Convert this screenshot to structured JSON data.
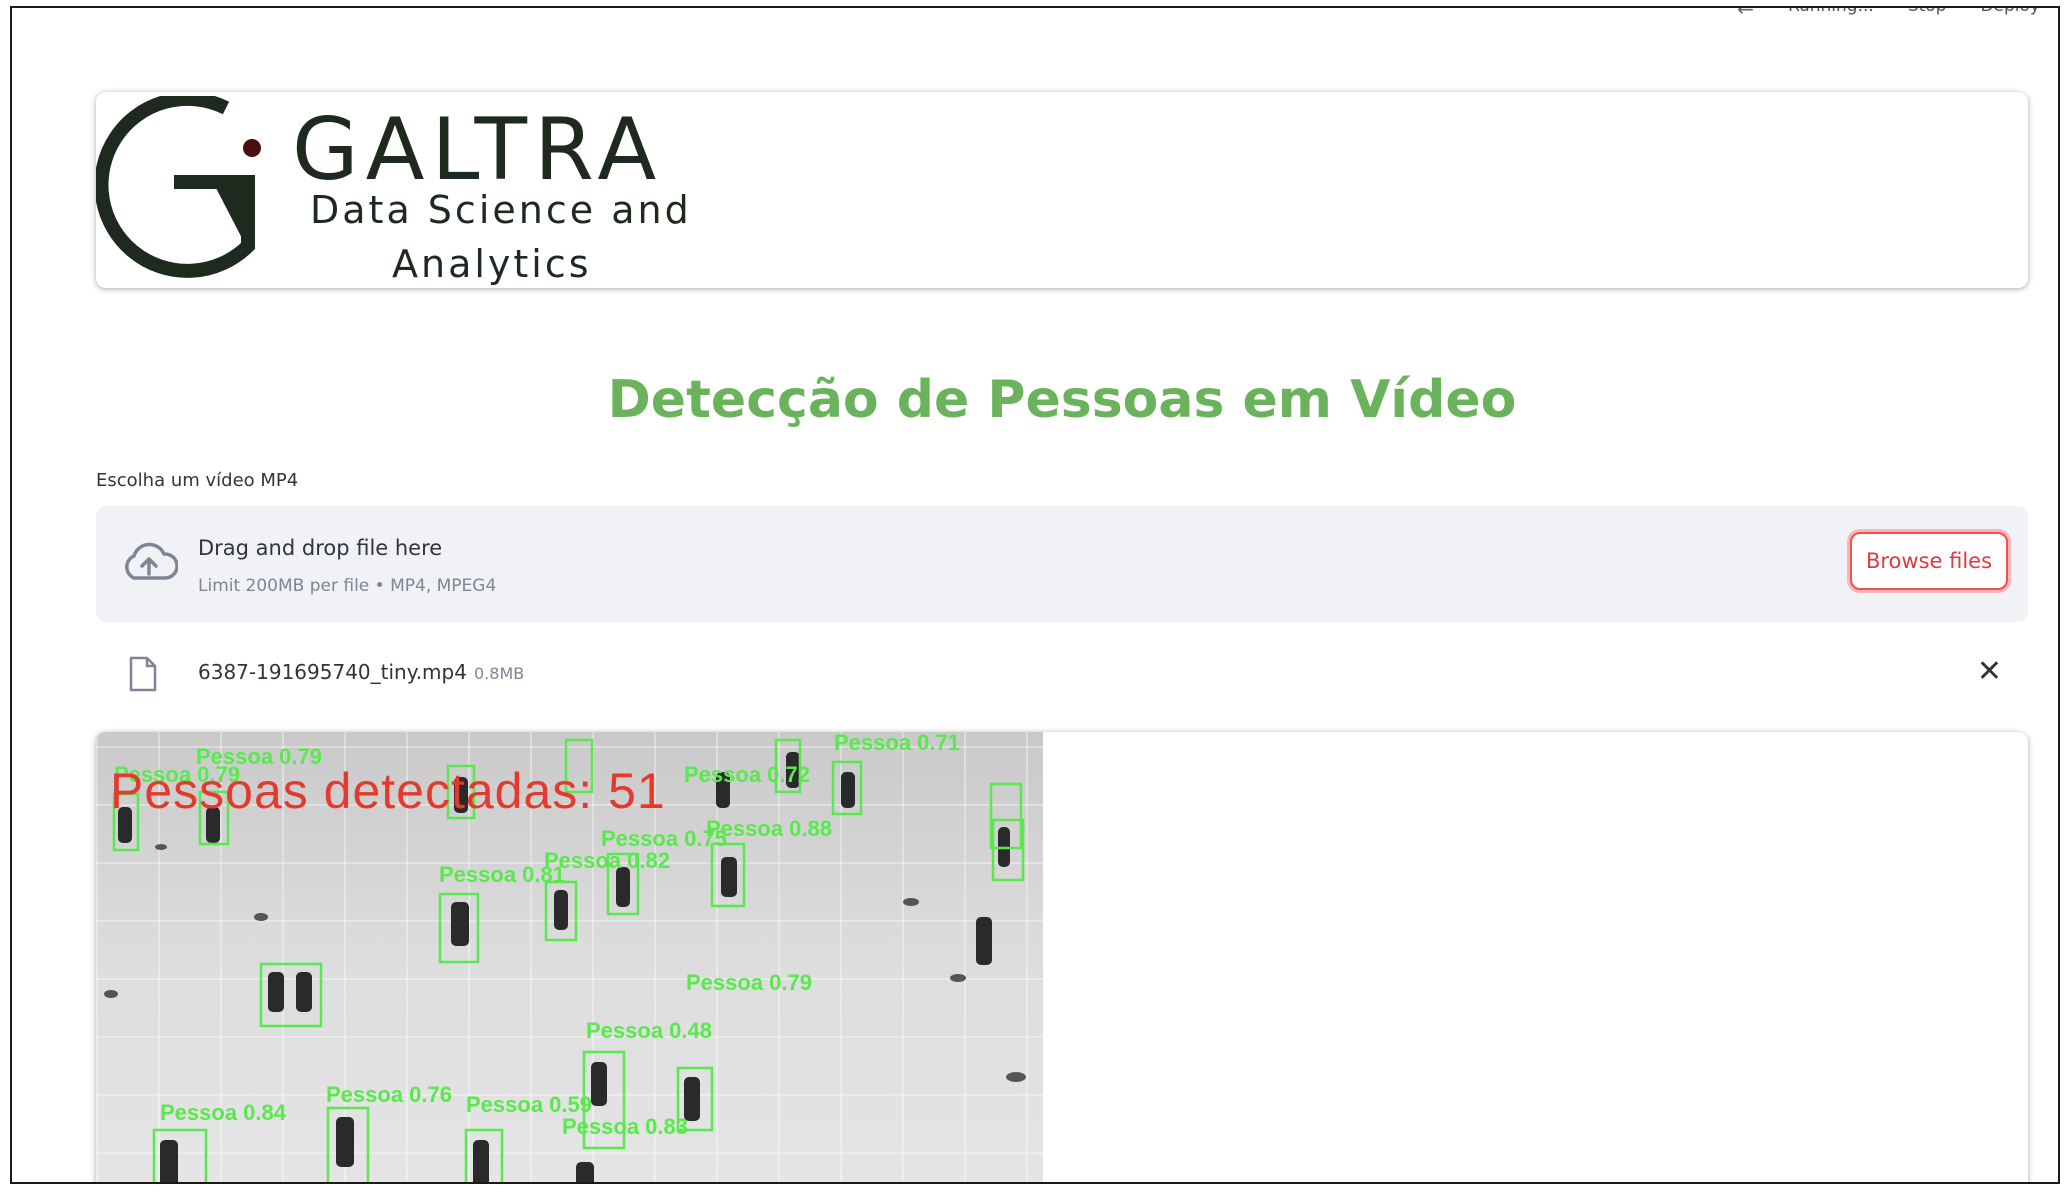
{
  "toolbar": {
    "running_label": "Running...",
    "stop_label": "Stop",
    "deploy_label": "Deploy"
  },
  "logo": {
    "title": "GALTRA",
    "subtitle_line1": "Data Science and",
    "subtitle_line2": "Analytics"
  },
  "page": {
    "title": "Detecção de Pessoas em Vídeo"
  },
  "uploader": {
    "label": "Escolha um vídeo MP4",
    "drop_text": "Drag and drop file here",
    "limit_text": "Limit 200MB per file • MP4, MPEG4",
    "browse_label": "Browse files",
    "icon": "cloud-upload-icon"
  },
  "file": {
    "name": "6387-191695740_tiny.mp4",
    "size": "0.8MB",
    "icon": "file-icon",
    "remove_icon": "close-icon"
  },
  "video": {
    "count_text": "Pessoas detectadas: 51",
    "detections": [
      "Pessoa 0.79",
      "Pessoa 0.79",
      "Pessoa 0.72",
      "Pessoa 0.71",
      "Pessoa 0.88",
      "Pessoa 0.75",
      "Pessoa 0.82",
      "Pessoa 0.81",
      "Pessoa 0.79",
      "Pessoa 0.48",
      "Pessoa 0.84",
      "Pessoa 0.76",
      "Pessoa 0.59",
      "Pessoa 0.83"
    ]
  },
  "colors": {
    "title_green": "#6ab35c",
    "accent_red": "#ff4b4b",
    "detection_green": "#59e84d",
    "count_red": "#e23b2e"
  }
}
